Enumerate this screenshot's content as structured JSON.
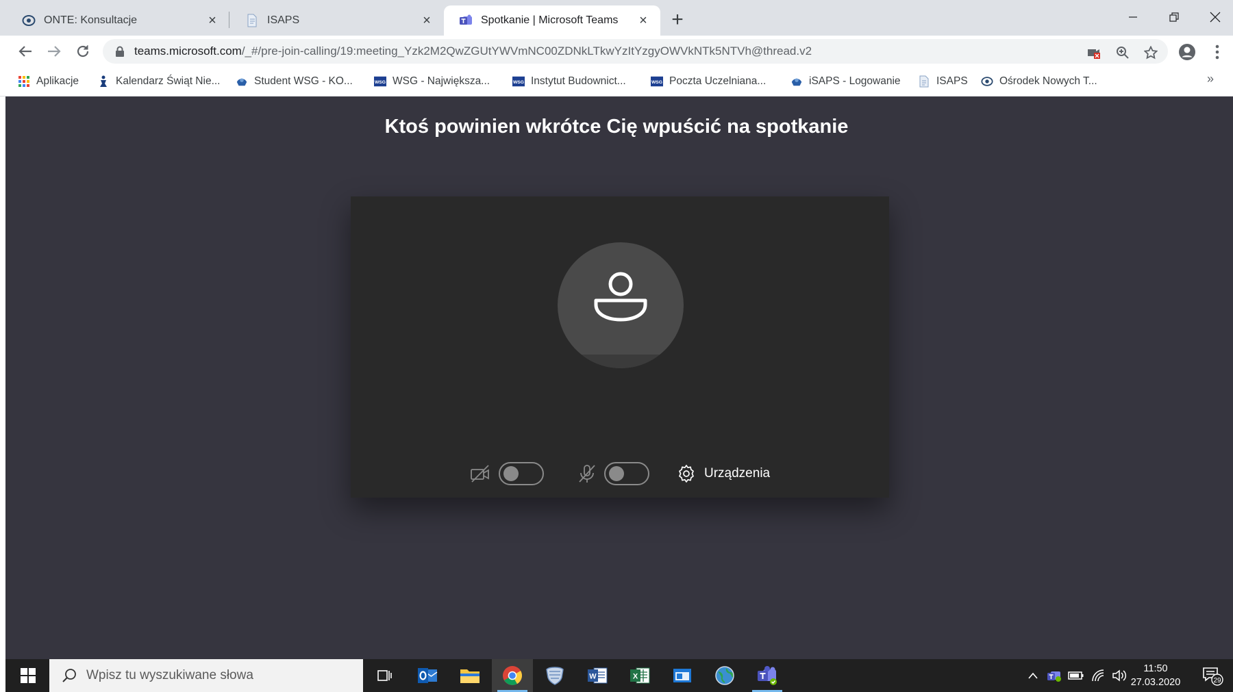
{
  "browser": {
    "tabs": [
      {
        "title": "ONTE: Konsultacje",
        "icon": "onte-favicon-icon",
        "active": false
      },
      {
        "title": "ISAPS",
        "icon": "document-favicon-icon",
        "active": false
      },
      {
        "title": "Spotkanie | Microsoft Teams",
        "icon": "teams-favicon-icon",
        "active": true
      }
    ],
    "new_tab_symbol": "+",
    "url_host": "teams.microsoft.com",
    "url_path": "/_#/pre-join-calling/19:meeting_Yzk2M2QwZGUtYWVmNC00ZDNkLTkwYzItYzgyOWVkNTk5NTVh@thread.v2",
    "bookmarks": [
      {
        "label": "Aplikacje",
        "icon": "apps-grid-icon"
      },
      {
        "label": "Kalendarz Świąt Nie...",
        "icon": "calendar-figure-icon"
      },
      {
        "label": "Student WSG - KO...",
        "icon": "student-crest-icon"
      },
      {
        "label": "WSG - Największa...",
        "icon": "wsg-logo-icon"
      },
      {
        "label": "Instytut Budownict...",
        "icon": "wsg-logo-icon"
      },
      {
        "label": "Poczta Uczelniana...",
        "icon": "wsg-logo-icon"
      },
      {
        "label": "iSAPS - Logowanie",
        "icon": "isaps-crest-icon"
      },
      {
        "label": "ISAPS",
        "icon": "document-favicon-icon"
      },
      {
        "label": "Ośrodek Nowych T...",
        "icon": "onte-favicon-icon"
      }
    ],
    "bookmarks_more": "»"
  },
  "teams": {
    "heading": "Ktoś powinien wkrótce Cię wpuścić na spotkanie",
    "camera_on": false,
    "mic_on": false,
    "devices_label": "Urządzenia"
  },
  "taskbar": {
    "search_placeholder": "Wpisz tu wyszukiwane słowa",
    "apps": [
      "task-view",
      "outlook",
      "file-explorer",
      "chrome",
      "security-shield",
      "word",
      "excel",
      "window-app",
      "globe-app",
      "teams"
    ],
    "time": "11:50",
    "date": "27.03.2020",
    "notification_count": "29"
  },
  "colors": {
    "page_bg": "#36353f",
    "preview_bg": "#292929",
    "teams_purple": "#6264a7",
    "chrome_tabstrip": "#dee1e6"
  }
}
